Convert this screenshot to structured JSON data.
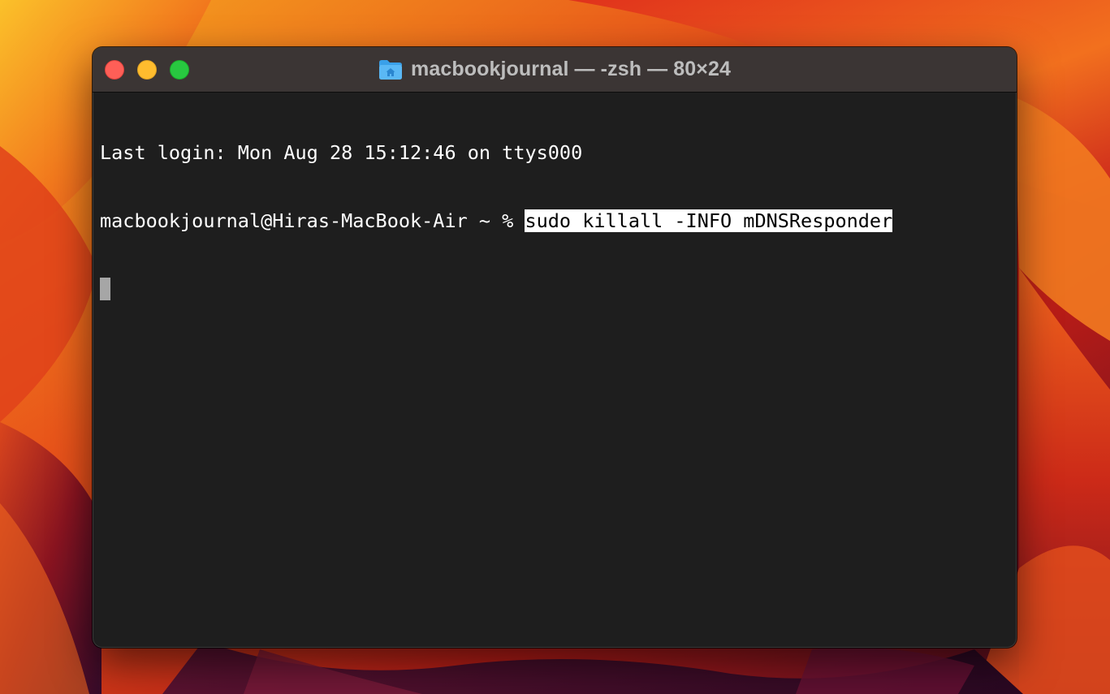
{
  "window": {
    "title": "macbookjournal — -zsh — 80×24",
    "title_icon": "home-folder-icon"
  },
  "terminal": {
    "last_login": "Last login: Mon Aug 28 15:12:46 on ttys000",
    "prompt": "macbookjournal@Hiras-MacBook-Air ~ % ",
    "command": "sudo killall -INFO mDNSResponder"
  },
  "colors": {
    "terminal_background": "#1e1e1e",
    "titlebar_background": "#3b3534",
    "text": "#ffffff",
    "selection_background": "#ffffff",
    "cursor": "#a6a6a6",
    "close": "#fe5f57",
    "minimize": "#febc2e",
    "zoom": "#28c840"
  }
}
